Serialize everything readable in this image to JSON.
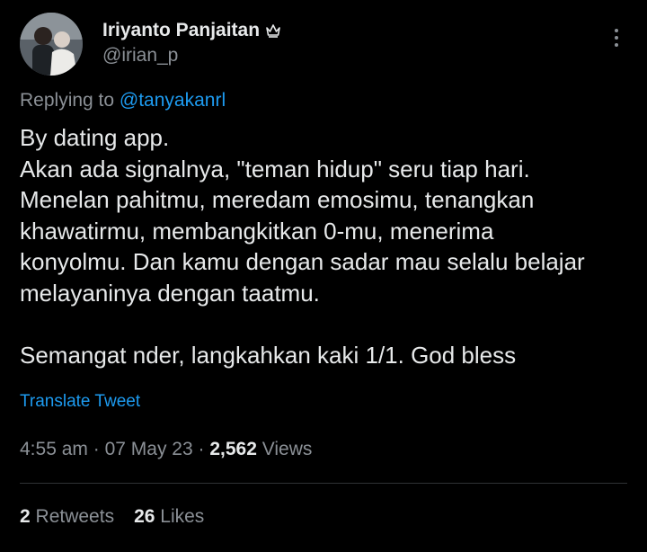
{
  "tweet": {
    "author": {
      "display_name": "Iriyanto Panjaitan",
      "handle": "@irian_p",
      "badge_icon": "crown-icon"
    },
    "replying_prefix": "Replying to",
    "replying_to": "@tanyakanrl",
    "text": "By dating app.\nAkan ada signalnya, \"teman hidup\" seru tiap hari.\nMenelan pahitmu, meredam emosimu, tenangkan\nkhawatirmu, membangkitkan 0-mu, menerima\nkonyolmu. Dan kamu dengan sadar mau selalu belajar\nmelayaninya dengan taatmu.\n\nSemangat nder, langkahkan kaki 1/1. God bless",
    "translate_label": "Translate Tweet",
    "time": "4:55 am",
    "date": "07 May 23",
    "views_count": "2,562",
    "views_label": "Views",
    "separator": "·",
    "retweets_count": "2",
    "retweets_label": "Retweets",
    "likes_count": "26",
    "likes_label": "Likes"
  },
  "colors": {
    "background": "#000000",
    "text_primary": "#e7e9ea",
    "text_secondary": "#8b9096",
    "link": "#1d9bf0",
    "divider": "#2f3336"
  }
}
